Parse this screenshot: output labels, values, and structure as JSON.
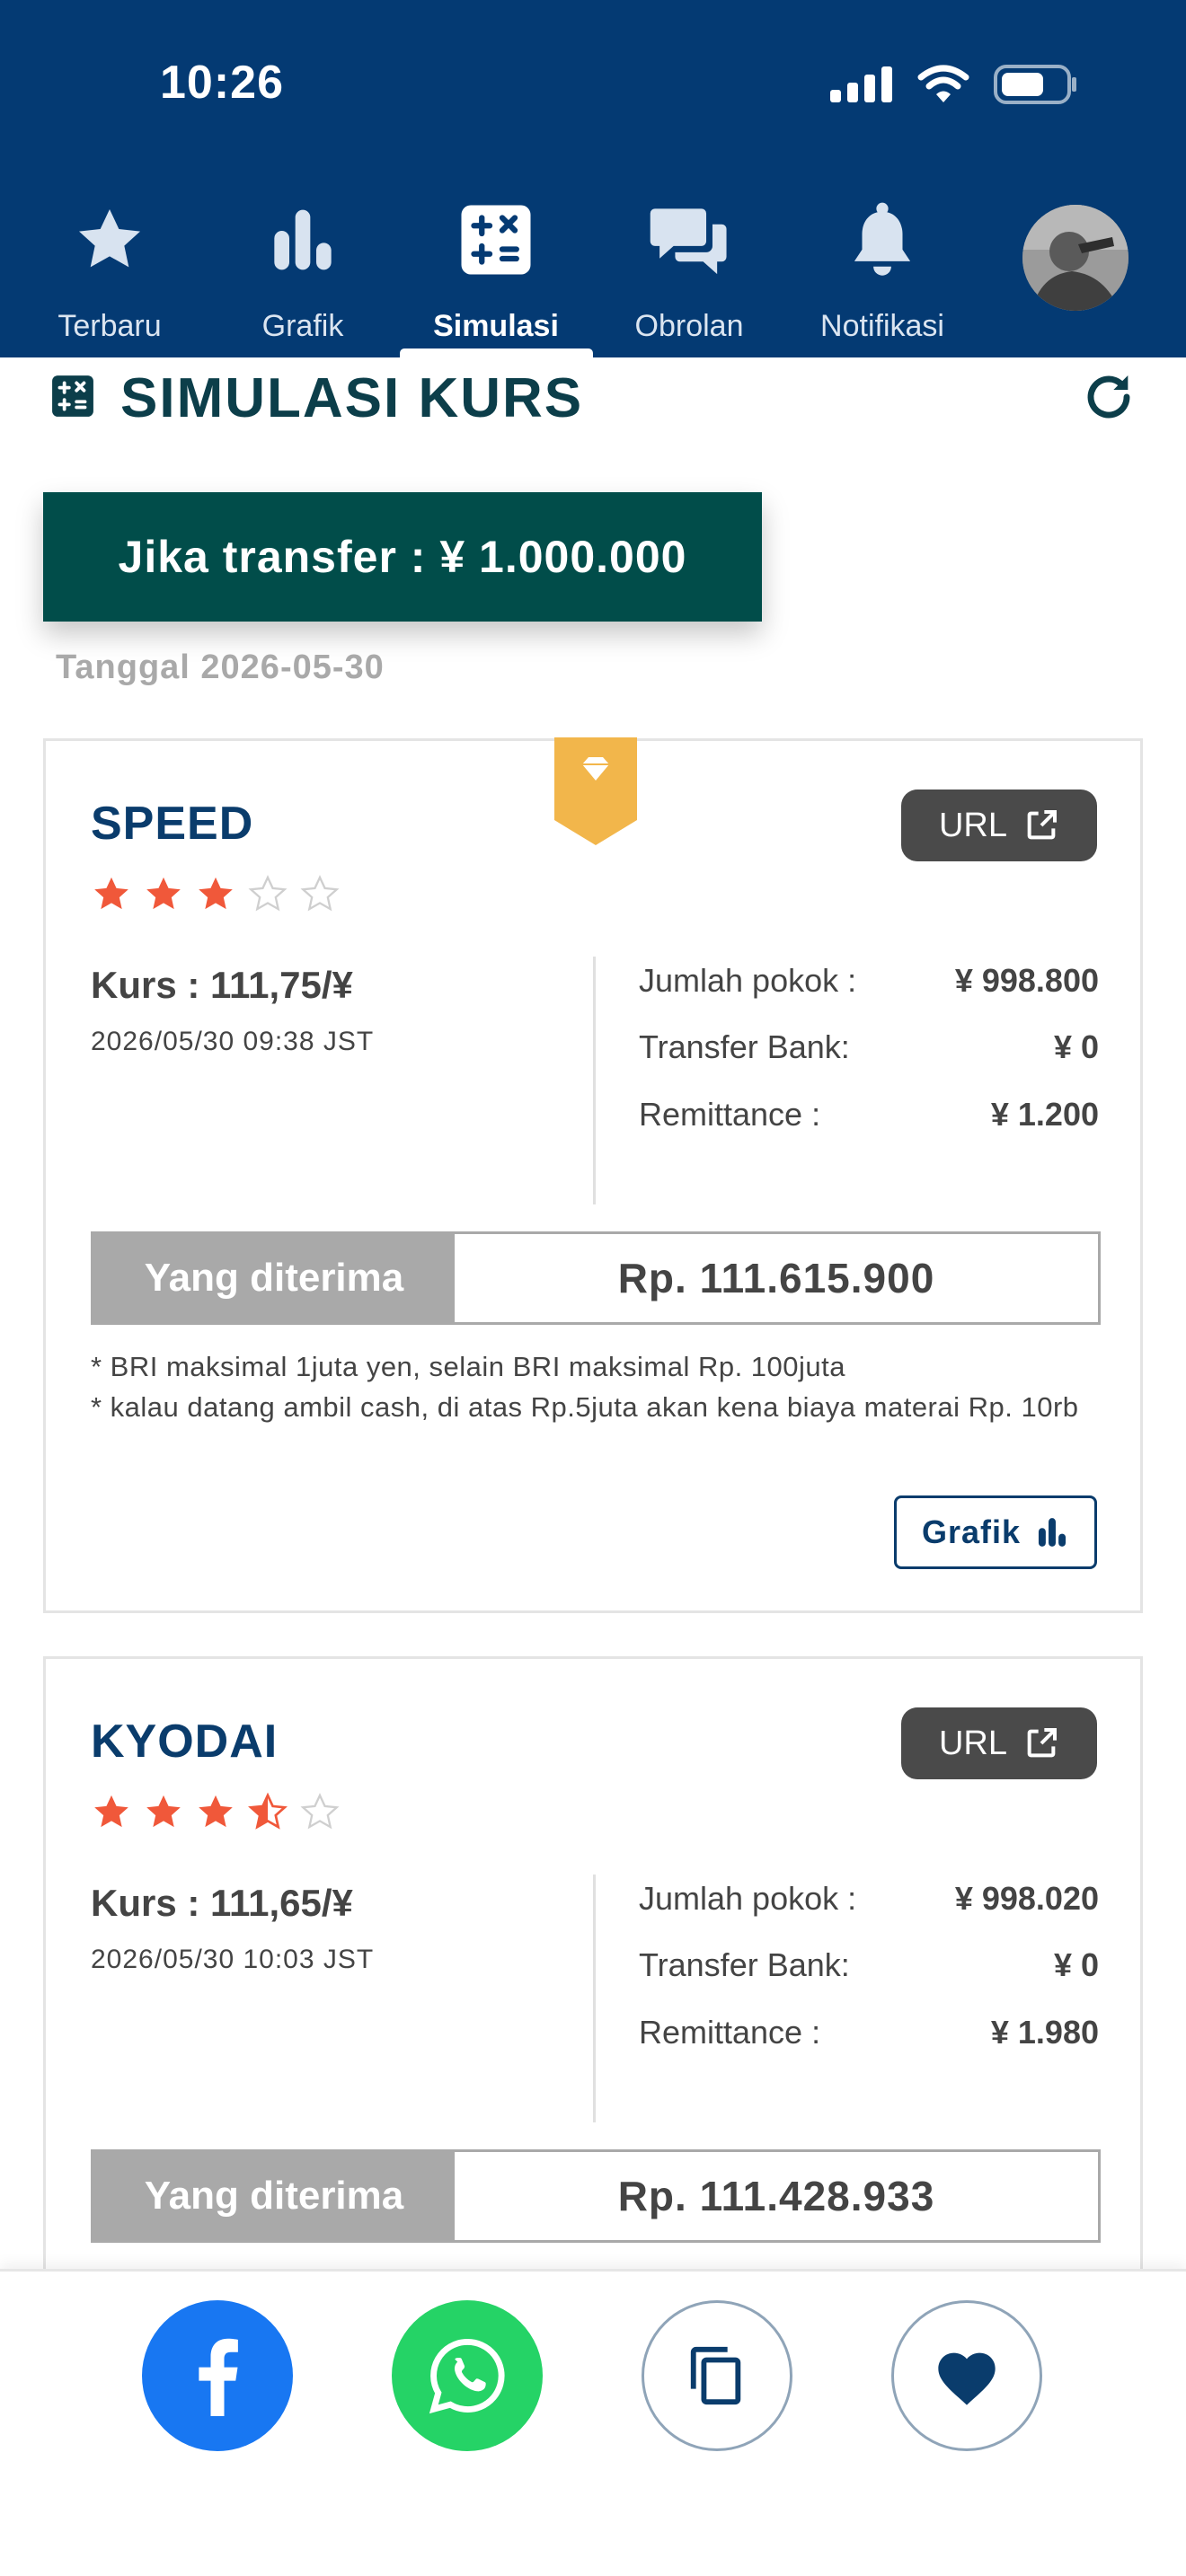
{
  "status_bar": {
    "time": "10:26"
  },
  "nav": {
    "items": [
      {
        "label": "Terbaru",
        "icon": "star-icon"
      },
      {
        "label": "Grafik",
        "icon": "bar-chart-icon"
      },
      {
        "label": "Simulasi",
        "icon": "calculator-icon",
        "active": true
      },
      {
        "label": "Obrolan",
        "icon": "chat-icon"
      },
      {
        "label": "Notifikasi",
        "icon": "bell-icon"
      }
    ]
  },
  "page": {
    "title": "SIMULASI KURS",
    "transfer_label": "Jika transfer : ¥ 1.000.000",
    "date_label": "Tanggal 2026-05-30"
  },
  "cards": [
    {
      "name": "SPEED",
      "rating": 3,
      "url_label": "URL",
      "rate": "Kurs : 111,75/¥",
      "rate_time": "2026/05/30 09:38 JST",
      "details": [
        {
          "label": "Jumlah pokok :",
          "value": "¥ 998.800"
        },
        {
          "label": "Transfer Bank:",
          "value": "¥ 0"
        },
        {
          "label": "Remittance :",
          "value": "¥ 1.200"
        }
      ],
      "received_label": "Yang diterima",
      "received_value": "Rp. 111.615.900",
      "notes": [
        "* BRI maksimal 1juta yen, selain BRI maksimal Rp. 100juta",
        "* kalau datang ambil cash, di atas Rp.5juta akan kena biaya materai Rp. 10rb"
      ],
      "chart_button": "Grafik"
    },
    {
      "name": "KYODAI",
      "rating": 3.5,
      "url_label": "URL",
      "rate": "Kurs : 111,65/¥",
      "rate_time": "2026/05/30 10:03 JST",
      "details": [
        {
          "label": "Jumlah pokok :",
          "value": "¥ 998.020"
        },
        {
          "label": "Transfer Bank:",
          "value": "¥ 0"
        },
        {
          "label": "Remittance :",
          "value": "¥ 1.980"
        }
      ],
      "received_label": "Yang diterima",
      "received_value": "Rp. 111.428.933"
    }
  ],
  "share_bar": {
    "buttons": [
      "facebook-icon",
      "whatsapp-icon",
      "copy-icon",
      "heart-icon"
    ]
  },
  "colors": {
    "header_bg": "#043a73",
    "transfer_bg": "#014d4a",
    "star_filled": "#f0583a",
    "badge": "#f2b64b",
    "facebook": "#1877f2",
    "whatsapp": "#25d366"
  }
}
